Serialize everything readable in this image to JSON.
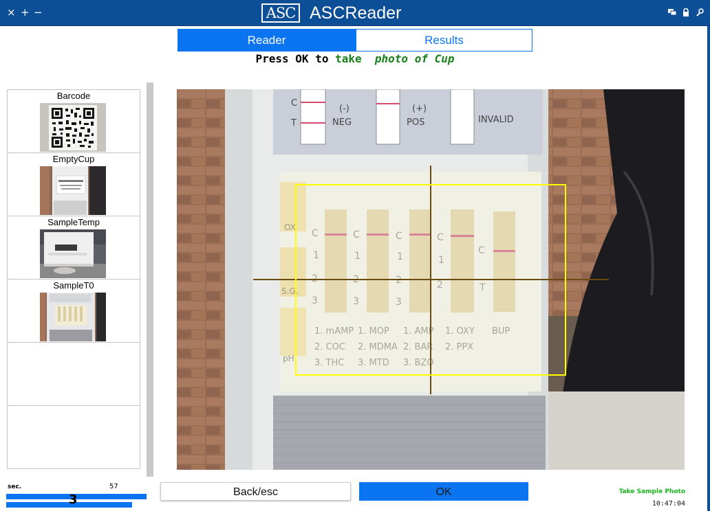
{
  "titlebar": {
    "close": "×",
    "maximize": "+",
    "minimize": "−",
    "logo": "ASC",
    "title": "ASCReader"
  },
  "tabs": [
    {
      "label": "Reader",
      "active": true
    },
    {
      "label": "Results",
      "active": false
    }
  ],
  "instruction": {
    "press": "Press OK to ",
    "take": "take",
    "target": "photo of Cup"
  },
  "thumbnails": [
    {
      "label": "Barcode"
    },
    {
      "label": "EmptyCup"
    },
    {
      "label": "SampleTemp"
    },
    {
      "label": "SampleT0"
    },
    {
      "label": ""
    },
    {
      "label": ""
    }
  ],
  "camera": {
    "top_labels": [
      "C",
      "T",
      "(-)",
      "NEG",
      "(+)",
      "POS",
      "INVALID"
    ],
    "side_labels": [
      "OX",
      "S.G.",
      "pH"
    ],
    "strip_letters": [
      "C",
      "1",
      "2",
      "3",
      "T"
    ],
    "drug_labels": [
      "1. mAMP",
      "2. COC",
      "3. THC",
      "1. MOP",
      "2. MDMA",
      "3. MTD",
      "1. AMP",
      "2. BAR",
      "3. BZO",
      "1. OXY",
      "2. PPX",
      "BUP"
    ]
  },
  "footer": {
    "sec_label": "sec.",
    "sec_max": "57",
    "sec_count": "3",
    "back_label": "Back/esc",
    "ok_label": "OK",
    "status": "Take Sample Photo",
    "clock": "10:47:04"
  },
  "colors": {
    "titlebar": "#0d4f96",
    "accent": "#0b74f0",
    "instruction_green": "#17811a",
    "status_green": "#17b51d",
    "target_box": "#ffff00"
  }
}
